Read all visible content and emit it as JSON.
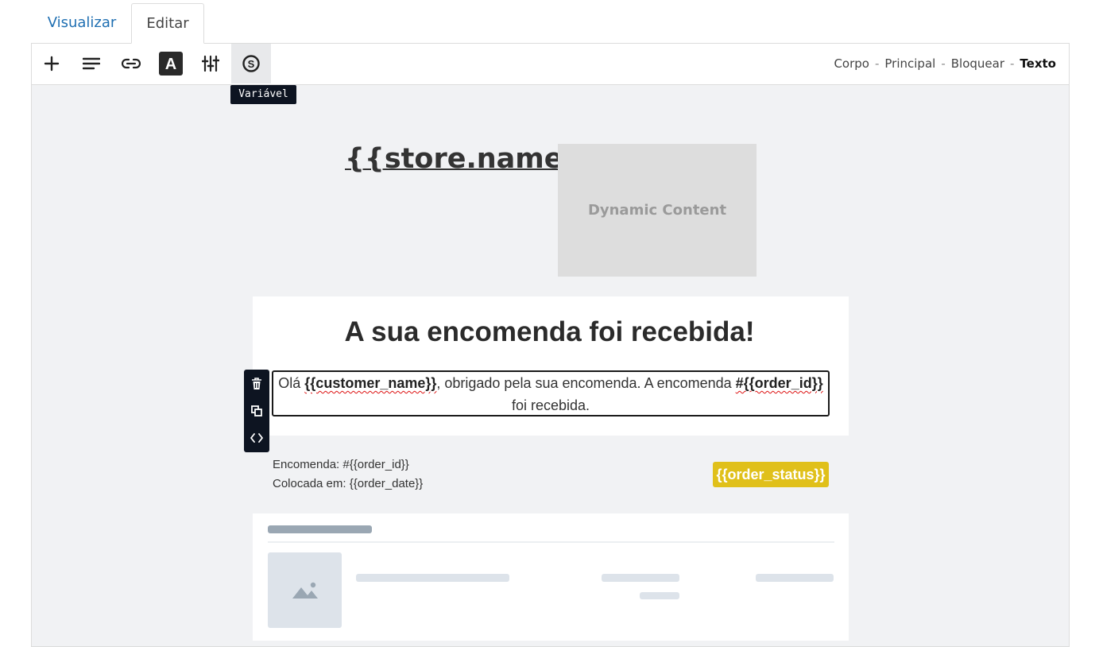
{
  "tabs": {
    "preview": "Visualizar",
    "edit": "Editar"
  },
  "toolbar": {
    "buttons": [
      "plus-icon",
      "align-left-icon",
      "link-icon",
      "text-style-icon",
      "sliders-icon",
      "variable-icon"
    ],
    "tooltip": "Variável"
  },
  "breadcrumb": {
    "items": [
      "Corpo",
      "Principal",
      "Bloquear"
    ],
    "current": "Texto",
    "separator": "-"
  },
  "email": {
    "store_name": "{{store.name}}",
    "dynamic_content": "Dynamic Content",
    "heading": "A sua encomenda foi recebida!",
    "greeting": {
      "prefix": "Olá ",
      "customer_var": "{{customer_name}}",
      "middle": ", obrigado pela sua encomenda. A encomenda ",
      "order_var": "#{{order_id}}",
      "suffix": " foi recebida."
    },
    "order_line": "Encomenda: #{{order_id}}",
    "placed_line": "Colocada em: {{order_date}}",
    "status_badge": "{{order_status}}"
  },
  "colors": {
    "accent_link": "#1f6fb2",
    "status_badge": "#e0c01a",
    "dark_ui": "#0d1421"
  }
}
